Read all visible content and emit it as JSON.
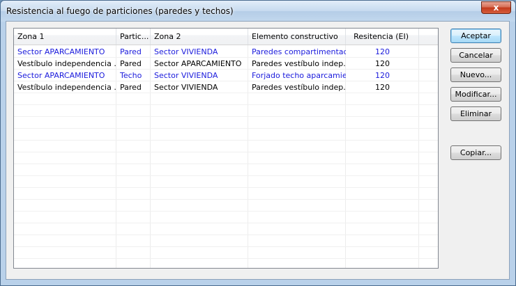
{
  "window": {
    "title": "Resistencia al fuego de particiones (paredes y techos)",
    "close_label": "x"
  },
  "table": {
    "columns": [
      "Zona 1",
      "Partic...",
      "Zona 2",
      "Elemento constructivo",
      "Resitencia (EI)"
    ],
    "rows": [
      {
        "zona1": "Sector APARCAMIENTO",
        "particion": "Pared",
        "zona2": "Sector VIVIENDA",
        "elemento": "Paredes compartimentad...",
        "resistencia": "120",
        "color": "#1a1adc"
      },
      {
        "zona1": "Vestíbulo independencia ...",
        "particion": "Pared",
        "zona2": "Sector APARCAMIENTO",
        "elemento": "Paredes vestíbulo indep...",
        "resistencia": "120",
        "color": "#000000"
      },
      {
        "zona1": "Sector APARCAMIENTO",
        "particion": "Techo",
        "zona2": "Sector VIVIENDA",
        "elemento": "Forjado techo aparcamie...",
        "resistencia": "120",
        "color": "#1a1adc"
      },
      {
        "zona1": "Vestíbulo independencia ...",
        "particion": "Pared",
        "zona2": "Sector VIVIENDA",
        "elemento": "Paredes vestíbulo indep...",
        "resistencia": "120",
        "color": "#000000"
      }
    ]
  },
  "buttons": {
    "aceptar": "Aceptar",
    "cancelar": "Cancelar",
    "nuevo": "Nuevo...",
    "modificar": "Modificar...",
    "eliminar": "Eliminar",
    "copiar": "Copiar..."
  }
}
